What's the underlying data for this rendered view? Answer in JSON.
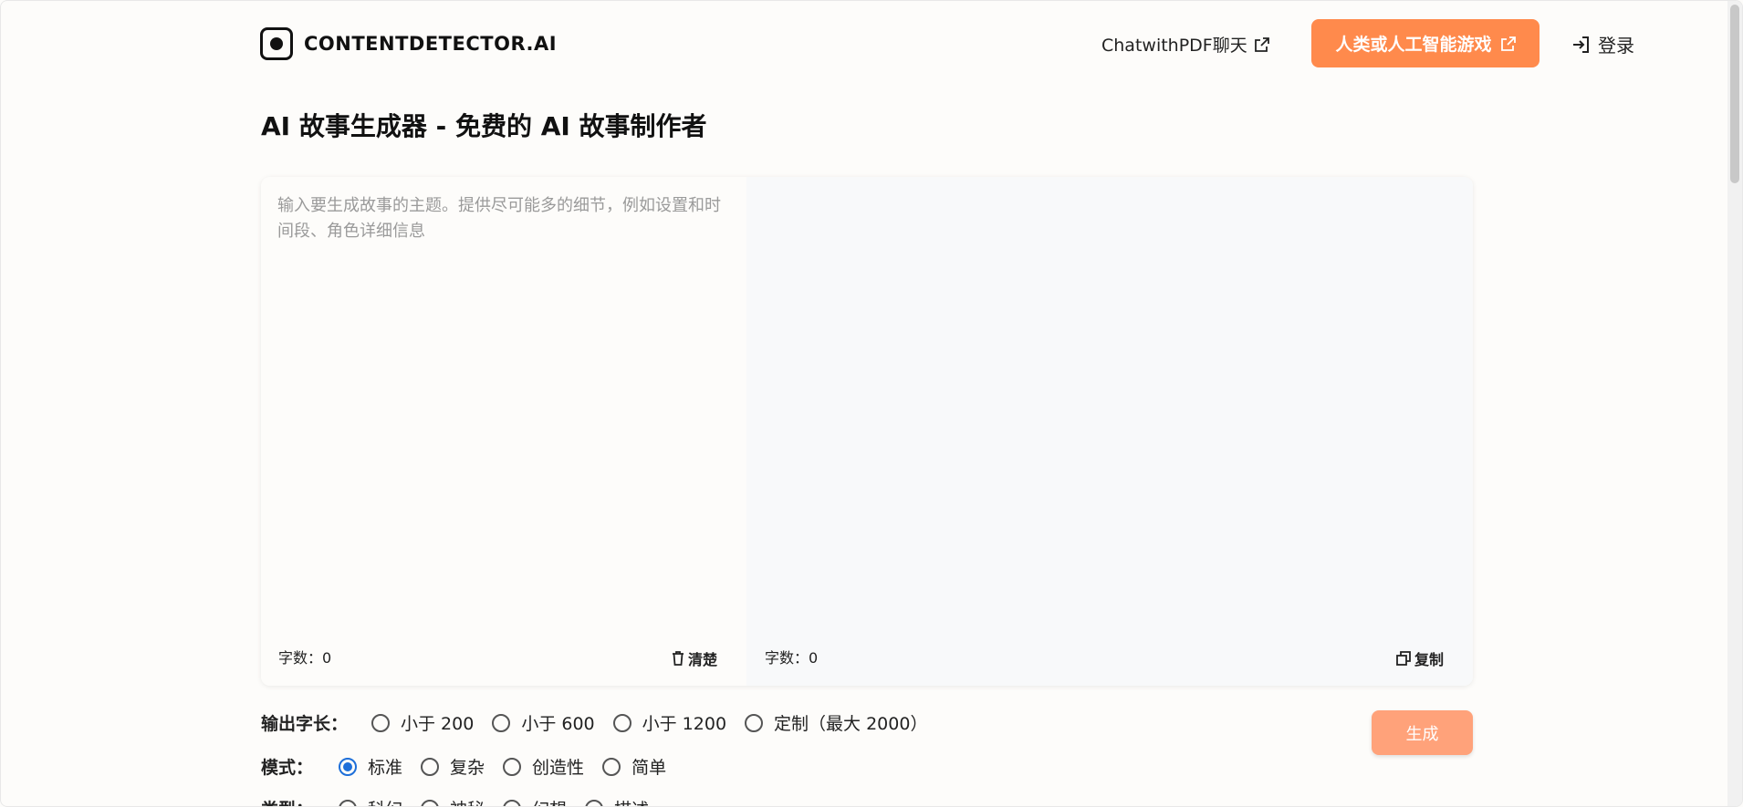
{
  "brand": {
    "name": "CONTENTDETECTOR.AI"
  },
  "nav": {
    "chat_pdf": "ChatwithPDF聊天",
    "game_button": "人类或人工智能游戏",
    "login": "登录"
  },
  "page": {
    "title": "AI 故事生成器 - 免费的 AI 故事制作者"
  },
  "editor": {
    "placeholder": "输入要生成故事的主题。提供尽可能多的细节，例如设置和时间段、角色详细信息",
    "input_count": "字数：0",
    "output_count": "字数：0",
    "clear_label": "清楚",
    "copy_label": "复制"
  },
  "options": {
    "length": {
      "label": "输出字长：",
      "choices": [
        "小于 200",
        "小于 600",
        "小于 1200",
        "定制（最大 2000）"
      ],
      "selected": null
    },
    "mode": {
      "label": "模式：",
      "choices": [
        "标准",
        "复杂",
        "创造性",
        "简单"
      ],
      "selected": "标准"
    },
    "genre": {
      "label": "类型：",
      "choices": [
        "科幻",
        "神秘",
        "幻想",
        "描述"
      ],
      "selected": null
    }
  },
  "generate_label": "生成",
  "colors": {
    "accent": "#ff8a4c",
    "generate": "#ffa27a",
    "radio_checked": "#1e6fd9"
  }
}
